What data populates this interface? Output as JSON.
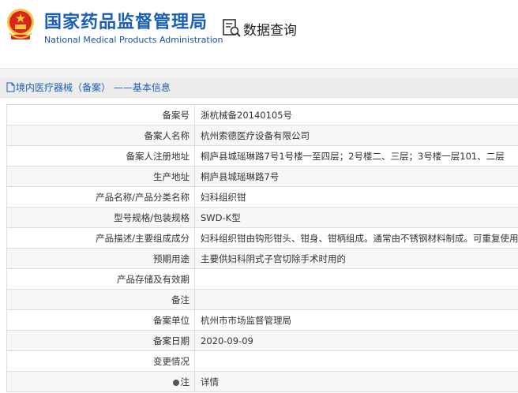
{
  "header": {
    "title_cn": "国家药品监督管理局",
    "title_en": "National Medical Products Administration",
    "search_title": "数据查询"
  },
  "breadcrumb": "境内医疗器械（备案） ——基本信息",
  "rows": [
    {
      "label": "备案号",
      "value": "浙杭械备20140105号"
    },
    {
      "label": "备案人名称",
      "value": "杭州索德医疗设备有限公司"
    },
    {
      "label": "备案人注册地址",
      "value": "桐庐县城瑶琳路7号1号楼一至四层；2号楼二、三层；3号楼一层101、二层"
    },
    {
      "label": "生产地址",
      "value": "桐庐县城瑶琳路7号"
    },
    {
      "label": "产品名称/产品分类名称",
      "value": "妇科组织钳"
    },
    {
      "label": "型号规格/包装规格",
      "value": "SWD-K型"
    },
    {
      "label": "产品描述/主要组成成分",
      "value": "妇科组织钳由钩形钳头、钳身、钳柄组成。通常由不锈钢材料制成。可重复使用"
    },
    {
      "label": "预期用途",
      "value": "主要供妇科阴式子宫切除手术时用的"
    },
    {
      "label": "产品存储及有效期",
      "value": ""
    },
    {
      "label": "备注",
      "value": ""
    },
    {
      "label": "备案单位",
      "value": "杭州市市场监督管理局"
    },
    {
      "label": "备案日期",
      "value": "2020-09-09"
    },
    {
      "label": "变更情况",
      "value": ""
    },
    {
      "label": "注",
      "value": "详情"
    }
  ],
  "colors": {
    "brand_blue": "#1a5fb4",
    "emblem_red": "#d8261c",
    "emblem_gold": "#f2c53d"
  }
}
